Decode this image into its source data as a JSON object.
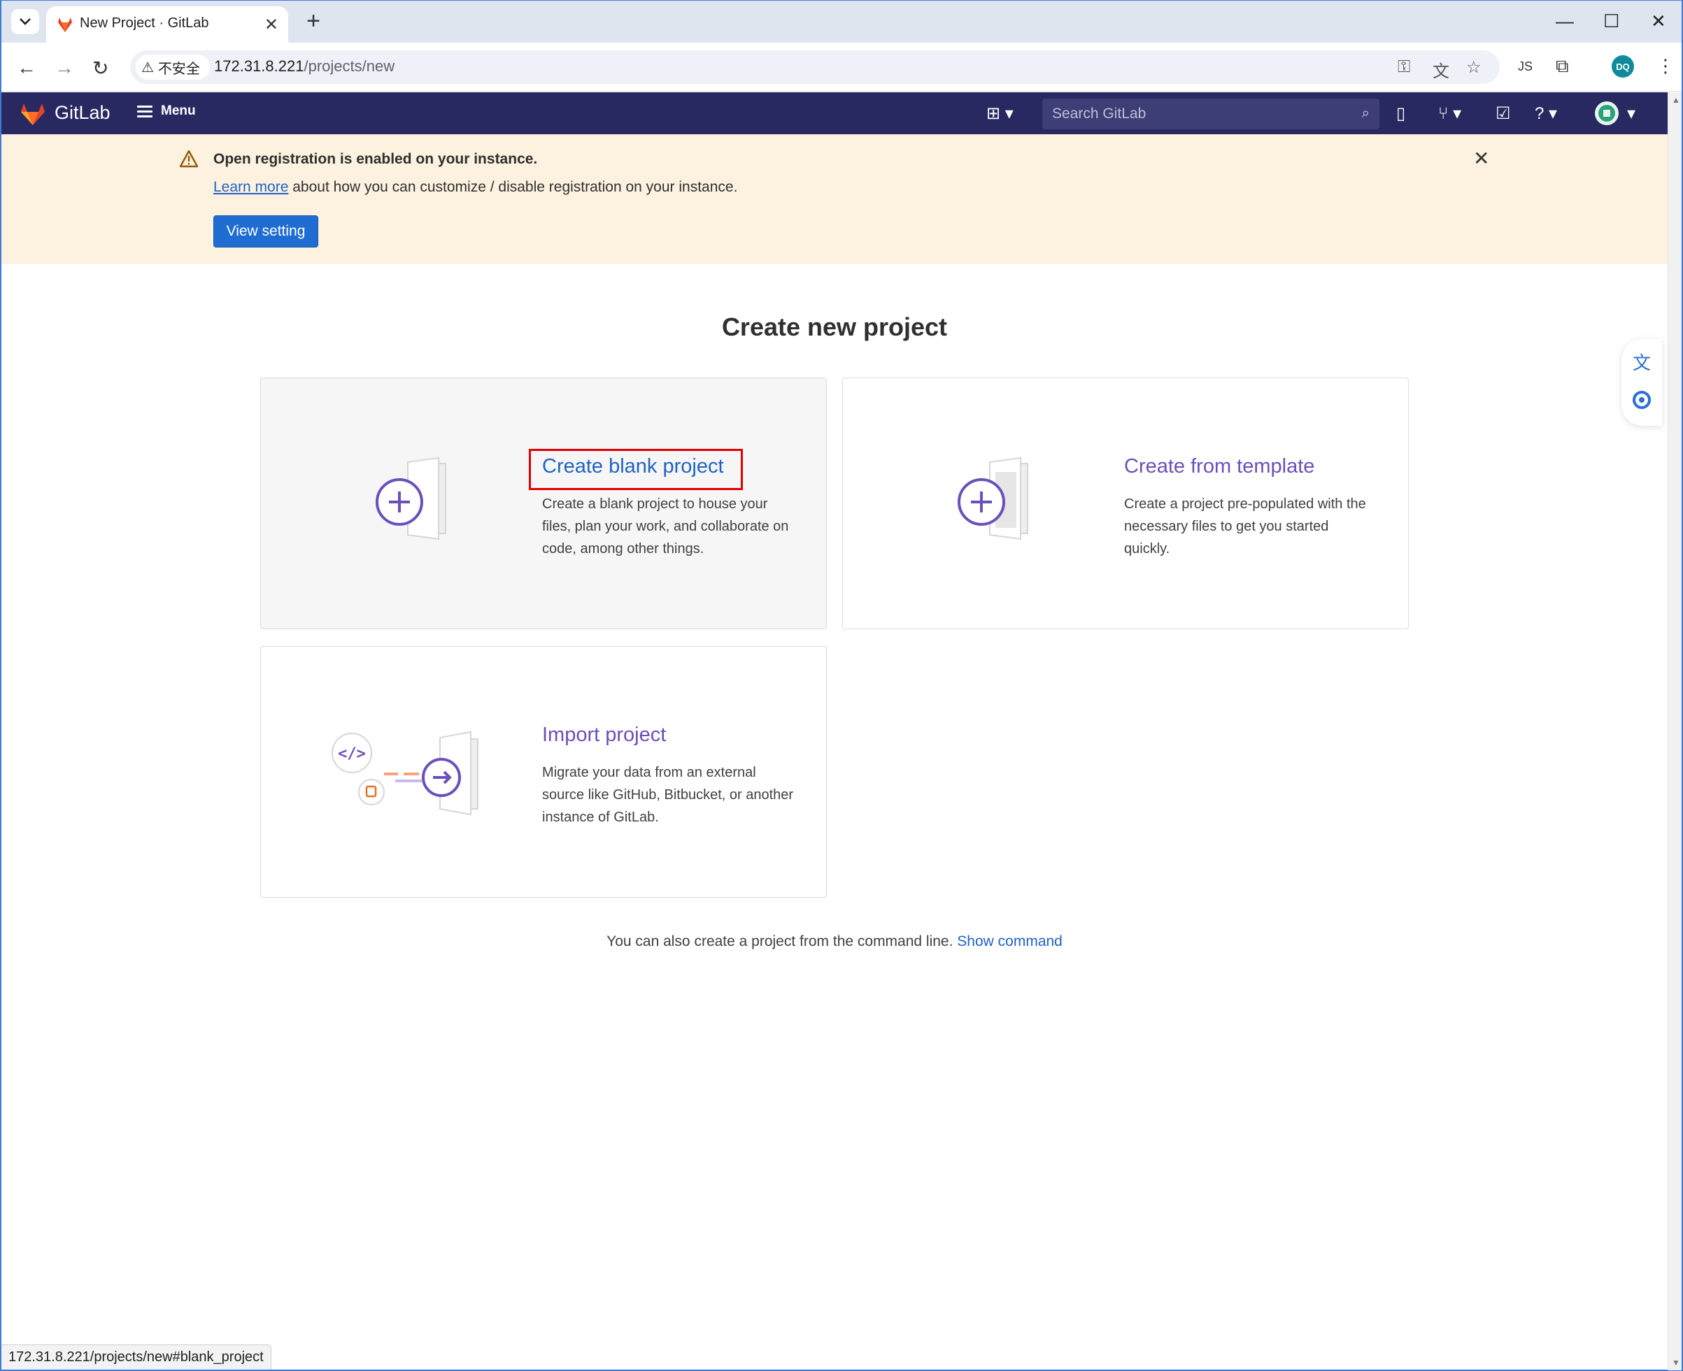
{
  "browser": {
    "tab_title": "New Project · GitLab",
    "security_label": "不安全",
    "url_host": "172.31.8.221",
    "url_path": "/projects/new",
    "profile_initials": "DQ",
    "status_url": "172.31.8.221/projects/new#blank_project"
  },
  "header": {
    "brand": "GitLab",
    "menu_label": "Menu",
    "search_placeholder": "Search GitLab"
  },
  "alert": {
    "title": "Open registration is enabled on your instance.",
    "link_text": "Learn more",
    "body_text": " about how you can customize / disable registration on your instance.",
    "button_label": "View setting"
  },
  "main": {
    "page_title": "Create new project",
    "cards": [
      {
        "title": "Create blank project",
        "description": "Create a blank project to house your files, plan your work, and collaborate on code, among other things."
      },
      {
        "title": "Create from template",
        "description": "Create a project pre-populated with the necessary files to get you started quickly."
      },
      {
        "title": "Import project",
        "description": "Migrate your data from an external source like GitHub, Bitbucket, or another instance of GitLab."
      }
    ],
    "cmdline_text": "You can also create a project from the command line. ",
    "cmdline_link": "Show command"
  },
  "colors": {
    "header_bg": "#292961",
    "accent_purple": "#6b4fbb",
    "link_blue": "#1f63c4",
    "alert_bg": "#fdf1df",
    "highlight_red": "#e00000"
  }
}
